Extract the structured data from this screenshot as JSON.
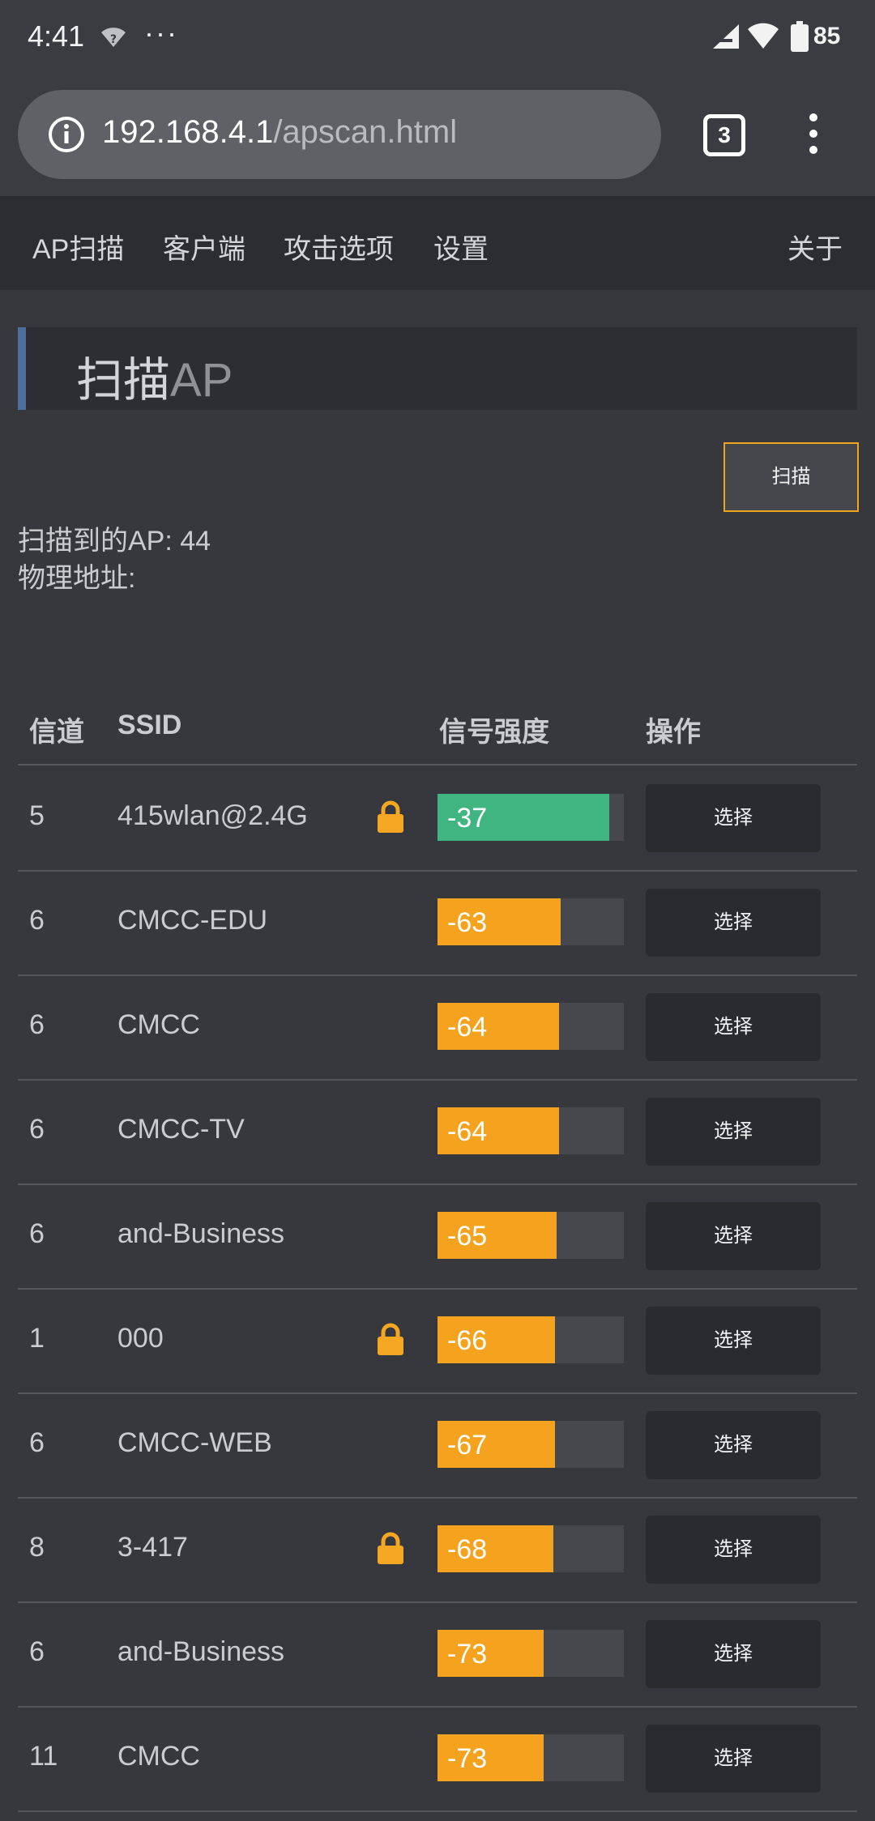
{
  "status_bar": {
    "time": "4:41",
    "notifications": "···",
    "battery": "85",
    "icons": [
      "wifi-question-icon",
      "signal-icon",
      "wifi-icon",
      "battery-icon"
    ]
  },
  "browser": {
    "url_host": "192.168.4.1",
    "url_path": "/apscan.html",
    "tab_count": "3",
    "icons": [
      "info-icon",
      "more-vert-icon"
    ]
  },
  "nav": {
    "items": [
      "AP扫描",
      "客户端",
      "攻击选项",
      "设置"
    ],
    "about": "关于"
  },
  "page": {
    "title_cn": "扫描",
    "title_en": "AP",
    "scan_button": "扫描",
    "ap_count": "扫描到的AP: 44",
    "mac_label": "物理地址:"
  },
  "table": {
    "headers": {
      "channel": "信道",
      "ssid": "SSID",
      "signal": "信号强度",
      "action": "操作"
    },
    "rows": [
      {
        "channel": "5",
        "ssid": "415wlan@2.4G",
        "locked": true,
        "rssi": "-37",
        "quality": 0.92,
        "action": "选择"
      },
      {
        "channel": "6",
        "ssid": "CMCC-EDU",
        "locked": false,
        "rssi": "-63",
        "quality": 0.66,
        "action": "选择"
      },
      {
        "channel": "6",
        "ssid": "CMCC",
        "locked": false,
        "rssi": "-64",
        "quality": 0.65,
        "action": "选择"
      },
      {
        "channel": "6",
        "ssid": "CMCC-TV",
        "locked": false,
        "rssi": "-64",
        "quality": 0.65,
        "action": "选择"
      },
      {
        "channel": "6",
        "ssid": "and-Business",
        "locked": false,
        "rssi": "-65",
        "quality": 0.64,
        "action": "选择"
      },
      {
        "channel": "1",
        "ssid": "000",
        "locked": true,
        "rssi": "-66",
        "quality": 0.63,
        "action": "选择"
      },
      {
        "channel": "6",
        "ssid": "CMCC-WEB",
        "locked": false,
        "rssi": "-67",
        "quality": 0.63,
        "action": "选择"
      },
      {
        "channel": "8",
        "ssid": "3-417",
        "locked": true,
        "rssi": "-68",
        "quality": 0.62,
        "action": "选择"
      },
      {
        "channel": "6",
        "ssid": "and-Business",
        "locked": false,
        "rssi": "-73",
        "quality": 0.57,
        "action": "选择"
      },
      {
        "channel": "11",
        "ssid": "CMCC",
        "locked": false,
        "rssi": "-73",
        "quality": 0.57,
        "action": "选择"
      }
    ]
  },
  "colors": {
    "strong_signal": "#41b581",
    "medium_signal": "#f5a21e",
    "accent_border": "#4e6f9c",
    "scan_button_border": "#f0a41b",
    "lock": "#f5a623"
  }
}
